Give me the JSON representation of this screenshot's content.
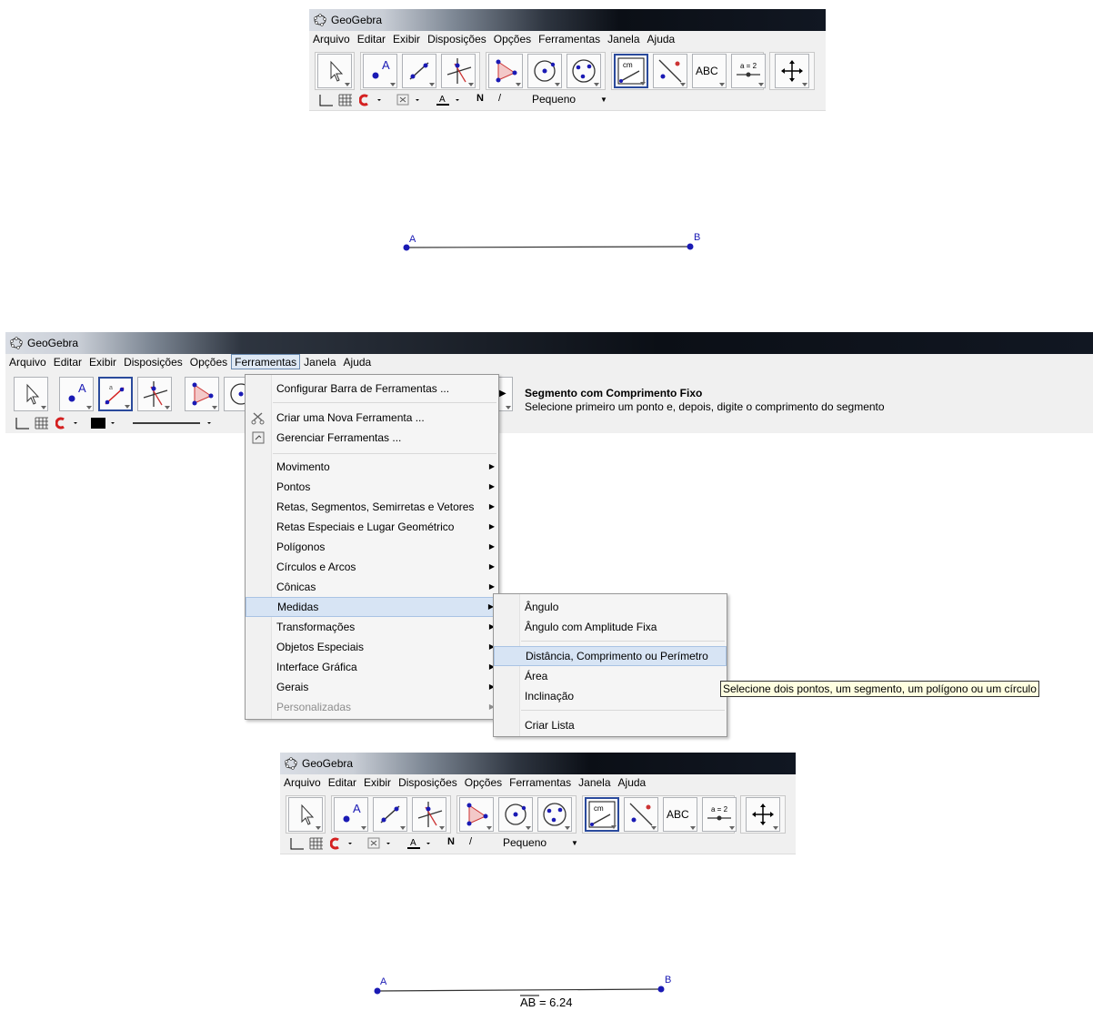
{
  "app_title": "GeoGebra",
  "menu": [
    "Arquivo",
    "Editar",
    "Exibir",
    "Disposições",
    "Opções",
    "Ferramentas",
    "Janela",
    "Ajuda"
  ],
  "toolbar_text": {
    "abc": "ABC",
    "slider": "a = 2",
    "cm": "cm"
  },
  "stylebar": {
    "font_size": "Pequeno",
    "bold": "N",
    "italic": "/",
    "text_color": "A"
  },
  "points": {
    "a": "A",
    "b": "B"
  },
  "measurement": "AB = 6.24",
  "help": {
    "title": "Segmento com Comprimento Fixo",
    "text": "Selecione primeiro um ponto e, depois, digite o comprimento do segmento"
  },
  "ferramentas_menu": {
    "top": [
      "Configurar Barra de Ferramentas ...",
      "Criar uma Nova Ferramenta ...",
      "Gerenciar Ferramentas ..."
    ],
    "categories": [
      "Movimento",
      "Pontos",
      "Retas, Segmentos, Semirretas e Vetores",
      "Retas Especiais e Lugar Geométrico",
      "Polígonos",
      "Círculos e Arcos",
      "Cônicas",
      "Medidas",
      "Transformações",
      "Objetos Especiais",
      "Interface Gráfica",
      "Gerais",
      "Personalizadas"
    ]
  },
  "medidas_submenu": [
    "Ângulo",
    "Ângulo com Amplitude Fixa",
    "Distância, Comprimento ou Perímetro",
    "Área",
    "Inclinação",
    "Criar Lista"
  ],
  "tooltip": "Selecione dois pontos, um segmento, um polígono ou um círculo",
  "colors": {
    "point": "#1a1ab4",
    "selected_border": "#2a4a9c",
    "highlight": "#d7e4f4"
  }
}
